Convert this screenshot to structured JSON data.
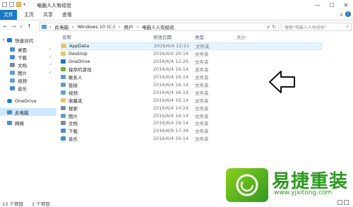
{
  "window": {
    "title": "电脑人人有经验",
    "minimize": "—",
    "maximize": "☐",
    "close": "✕"
  },
  "ribbon": {
    "tabs": [
      {
        "label": "文件"
      },
      {
        "label": "主页"
      },
      {
        "label": "共享"
      },
      {
        "label": "查看"
      }
    ],
    "toggle": "∨",
    "help": "?"
  },
  "address": {
    "back": "←",
    "forward": "→",
    "recent": "∨",
    "up": "↑",
    "parts": [
      "›",
      "此电脑",
      "›",
      "Windows 10 (C:)",
      "›",
      "用户",
      "›",
      "电脑人人有经验"
    ],
    "dropdown": "∨",
    "refresh": "↻"
  },
  "search": {
    "placeholder": "搜索\"电脑人人有经验\""
  },
  "sidebar": {
    "items": [
      {
        "label": "快速访问",
        "color": "#1979ca",
        "pinned": ""
      },
      {
        "label": "桌面",
        "color": "#3d8fd8",
        "pinned": "✓"
      },
      {
        "label": "下载",
        "color": "#3d8fd8",
        "pinned": "✓"
      },
      {
        "label": "文档",
        "color": "#7f8a96",
        "pinned": "✓"
      },
      {
        "label": "图片",
        "color": "#5aa0e0",
        "pinned": "✓"
      },
      {
        "label": "视频",
        "color": "#5aa0e0",
        "pinned": ""
      },
      {
        "label": "音乐",
        "color": "#3d8fd8",
        "pinned": ""
      },
      {
        "label": "OneDrive",
        "color": "#1979ca",
        "pinned": ""
      },
      {
        "label": "此电脑",
        "color": "#4f8fc7",
        "pinned": ""
      },
      {
        "label": "网络",
        "color": "#4f8fc7",
        "pinned": ""
      }
    ]
  },
  "columns": {
    "name": "名称",
    "date": "修改日期",
    "type": "类型",
    "size": "大小"
  },
  "files": [
    {
      "name": "AppData",
      "date": "2016/6/4 12:21",
      "type": "文件夹",
      "color": "#e8c55b"
    },
    {
      "name": "Desktop",
      "date": "2016/6/6 20:16",
      "type": "文件夹",
      "color": "#e8c55b"
    },
    {
      "name": "OneDrive",
      "date": "2016/6/4 12:26",
      "type": "文件夹",
      "color": "#1979ca"
    },
    {
      "name": "保存的游戏",
      "date": "2016/6/4 16:14",
      "type": "文件夹",
      "color": "#6bb33a"
    },
    {
      "name": "联系人",
      "date": "2016/6/4 16:14",
      "type": "文件夹",
      "color": "#5b9bd5"
    },
    {
      "name": "链接",
      "date": "2016/6/4 16:14",
      "type": "文件夹",
      "color": "#5b9bd5"
    },
    {
      "name": "视频",
      "date": "2016/6/4 16:14",
      "type": "文件夹",
      "color": "#5aa0e0"
    },
    {
      "name": "收藏夹",
      "date": "2016/6/4 16:14",
      "type": "文件夹",
      "color": "#e8c55b"
    },
    {
      "name": "搜索",
      "date": "2016/6/4 14:24",
      "type": "文件夹",
      "color": "#7f8a96"
    },
    {
      "name": "图片",
      "date": "2016/6/4 16:14",
      "type": "文件夹",
      "color": "#5aa0e0"
    },
    {
      "name": "文档",
      "date": "2016/6/4 16:14",
      "type": "文件夹",
      "color": "#7f8a96"
    },
    {
      "name": "下载",
      "date": "2016/6/9 17:38",
      "type": "文件夹",
      "color": "#3d8fd8"
    },
    {
      "name": "音乐",
      "date": "2016/6/4 16:14",
      "type": "文件夹",
      "color": "#3d8fd8"
    }
  ],
  "status": {
    "count": "13 个项目",
    "selected": "1 个项目"
  },
  "watermark": {
    "brand": "易捷重装",
    "url": "www.yjxitong.com"
  }
}
